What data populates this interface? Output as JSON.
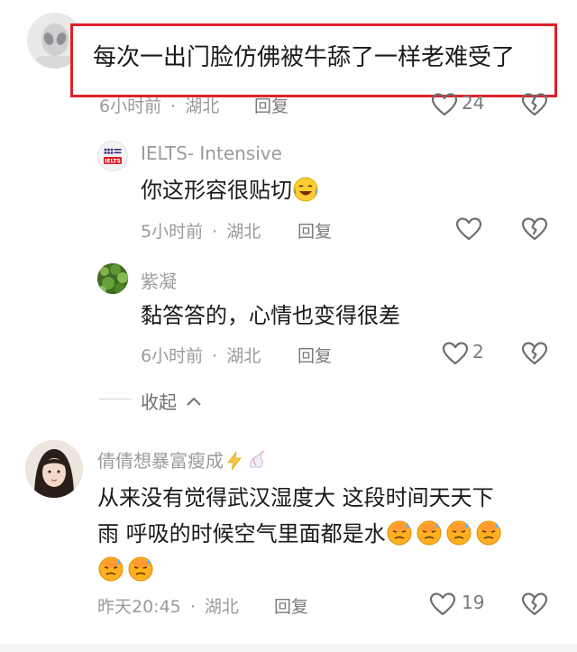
{
  "colors": {
    "highlight_border": "#e0202a",
    "meta_gray": "#9a9a9a",
    "text_dark": "#1a1a1a"
  },
  "top_comment": {
    "text": "每次一出门脸仿佛被牛舔了一样老难受了",
    "time": "6小时前",
    "location": "湖北",
    "reply_label": "回复",
    "like_count": "24",
    "avatar_icon": "alien-avatar"
  },
  "replies": [
    {
      "author": "IELTS- Intensive",
      "avatar_icon": "british-council-ielts-logo",
      "text": "你这形容很贴切",
      "emoji_icon": "crying-laughing-emoji",
      "time": "5小时前",
      "location": "湖北",
      "reply_label": "回复",
      "like_count": ""
    },
    {
      "author": "紫凝",
      "avatar_icon": "green-plant-avatar",
      "text": "黏答答的，心情也变得很差",
      "time": "6小时前",
      "location": "湖北",
      "reply_label": "回复",
      "like_count": "2"
    }
  ],
  "collapse_label": "收起",
  "comment3": {
    "author": "倩倩想暴富瘦成",
    "author_decor_icons": [
      "lightning-emoji",
      "unicorn-emoji"
    ],
    "text_line1": "从来没有觉得武汉湿度大 这段时间天天下",
    "text_line2": "雨 呼吸的时候空气里面都是水",
    "emoji_icon": "hot-sweating-face-emoji",
    "emoji_count": 6,
    "time": "昨天20:45",
    "location": "湖北",
    "reply_label": "回复",
    "like_count": "19",
    "avatar_icon": "girl-photo-avatar"
  },
  "meta_separator": "·"
}
